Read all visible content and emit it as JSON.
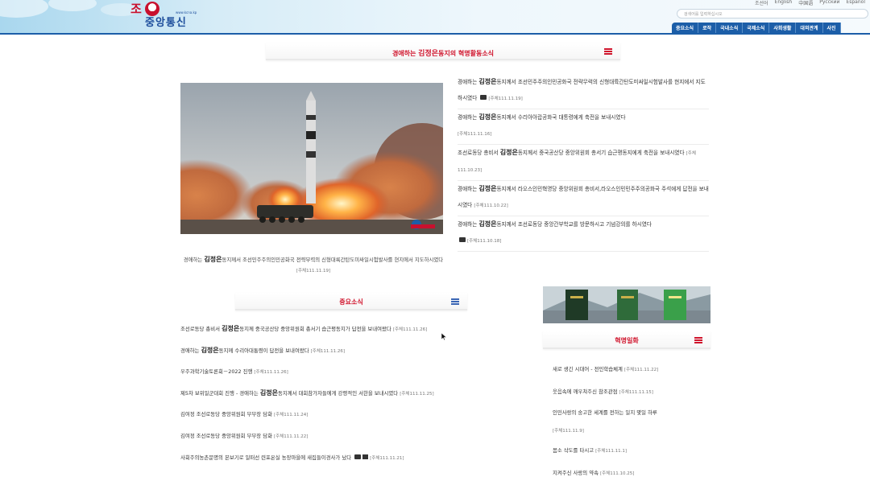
{
  "header": {
    "logo_top": "조선",
    "logo_url": "www.kcna.kp",
    "logo_bottom": "중앙통신",
    "languages": [
      "조선어",
      "English",
      "中国语",
      "Русский",
      "Español"
    ],
    "search_placeholder": "검색어를 입력하십시오",
    "nav": [
      "중요소식",
      "로작",
      "국내소식",
      "국제소식",
      "사회생활",
      "대외관계",
      "사진"
    ]
  },
  "feature": {
    "banner_title_pre": "경애하는 ",
    "banner_title_name": "김정은",
    "banner_title_post": "동지의 혁명활동소식",
    "caption_pre": "경애하는 ",
    "caption_name": "김정은",
    "caption_post": "동지께서 조선민주주의인민공화국 전략무력의 신형대륙간탄도미싸일시험발사를 현지에서 지도하시였다",
    "caption_date": "[주체111.11.19]"
  },
  "top_news": [
    {
      "pre": "경애하는 ",
      "name": "김정은",
      "post": "동지께서 조선민주주의인민공화국 전략무력의 신형대륙간탄도미싸일시험발사를 현지에서 지도하시였다",
      "date": "[주체111.11.19]",
      "camera": true
    },
    {
      "pre": "경애하는 ",
      "name": "김정은",
      "post": "동지께서 수리아아랍공화국 대통령에게 축전을 보내시였다",
      "date": "[주체111.11.16]",
      "camera": false
    },
    {
      "pre": "조선로동당 총비서 ",
      "name": "김정은",
      "post": "동지께서 중국공산당 중앙위원회 총서기 습근평동지에게 축전을 보내시였다",
      "date": "[주체111.10.23]",
      "camera": false
    },
    {
      "pre": "경애하는 ",
      "name": "김정은",
      "post": "동지께서 라오스인민혁명당 중앙위원회 총비서,라오스인민민주주의공화국 주석에게 답전을 보내시였다",
      "date": "[주체111.10.22]",
      "camera": false
    },
    {
      "pre": "경애하는 ",
      "name": "김정은",
      "post": "동지께서 조선로동당 중앙간부학교를 방문하시고 기념강의를 하시였다",
      "date": "[주체111.10.18]",
      "camera": true
    }
  ],
  "important": {
    "banner_title": "중요소식",
    "items": [
      {
        "pre": "조선로동당 총비서 ",
        "name": "김정은",
        "post": "동지께 중국공산당 중앙위원회 총서기 습근평동지가 답전을 보내여왔다",
        "date": "[주체111.11.26]",
        "icons": ""
      },
      {
        "pre": "경애하는 ",
        "name": "김정은",
        "post": "동지께 수리아대통령이 답전을 보내여왔다",
        "date": "[주체111.11.26]",
        "icons": ""
      },
      {
        "pre": "우주과학기술토론회－2022 진행",
        "name": "",
        "post": "",
        "date": "[주체111.11.26]",
        "icons": ""
      },
      {
        "pre": "제5차 보위일군대회 진행 - 경애하는 ",
        "name": "김정은",
        "post": "동지께서 대회참가자들에게 강령적인 서한을 보내시였다",
        "date": "[주체111.11.25]",
        "icons": ""
      },
      {
        "pre": "김여정 조선로동당 중앙위원회 부부장 담화",
        "name": "",
        "post": "",
        "date": "[주체111.11.24]",
        "icons": ""
      },
      {
        "pre": "김여정 조선로동당 중앙위원회 부부장 담화",
        "name": "",
        "post": "",
        "date": "[주체111.11.22]",
        "icons": ""
      },
      {
        "pre": "사회주의농촌문명의 본보기로 일떠선 련포온실 농장마을에 새집들이경사가 났다",
        "name": "",
        "post": "",
        "date": "[주체111.11.21]",
        "icons": "camera-video"
      }
    ]
  },
  "revolution": {
    "banner_title": "혁명일화",
    "items": [
      {
        "text": "새로 생긴 시대어 - 전민학습체계",
        "date": "[주체111.11.22]"
      },
      {
        "text": "웃음속에 깨우쳐주신 참조관점",
        "date": "[주체111.11.15]"
      },
      {
        "text": "인민사랑의 숭고한 세계를 전하는 일지 몇일 하루",
        "date": "[주체111.11.9]"
      },
      {
        "text": "몸소 삭도를 타시고",
        "date": "[주체111.11.1]"
      },
      {
        "text": "지켜주신 사랑의 약속",
        "date": "[주체111.10.25]"
      }
    ]
  },
  "colors": {
    "brand_red": "#d0142c",
    "nav_blue": "#1c5ea8"
  }
}
